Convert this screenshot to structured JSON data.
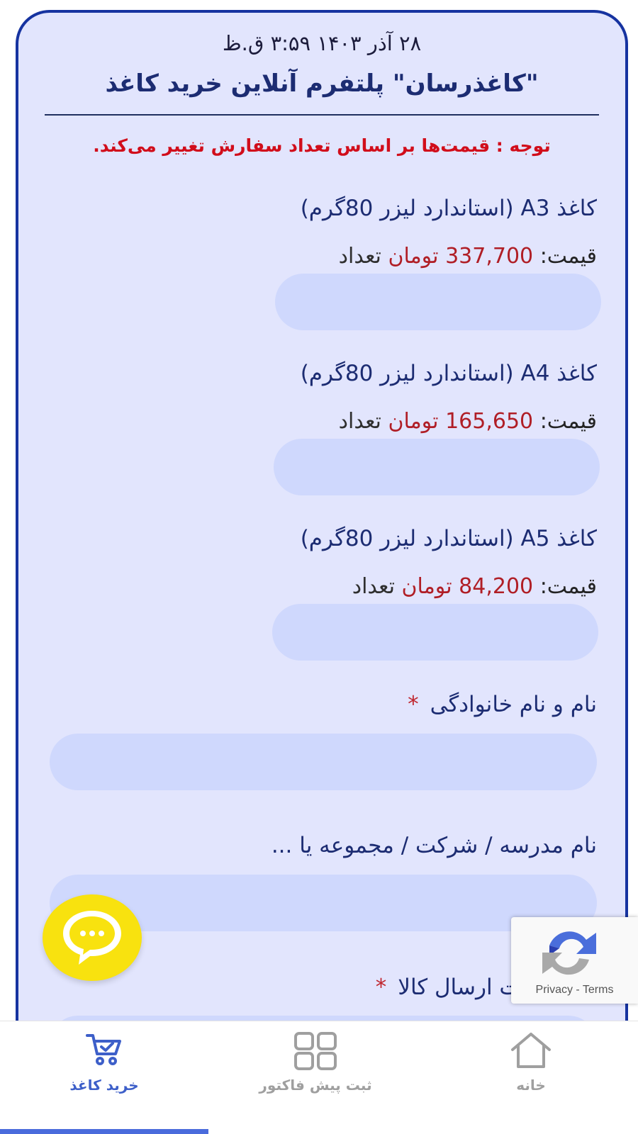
{
  "header": {
    "date": "۲۸ آذر ۱۴۰۳ ۳:۵۹ ق.ظ",
    "title": "\"کاغذرسان\" پلتفرم آنلاین خرید کاغذ",
    "notice": "توجه : قیمت‌ها بر اساس تعداد سفارش تغییر می‌کند."
  },
  "products": [
    {
      "name": "کاغذ A3 (استاندارد لیزر 80گرم)",
      "price_label": "قیمت:",
      "price": "337,700",
      "currency": "تومان",
      "qty_label": "تعداد",
      "qty_value": ""
    },
    {
      "name": "کاغذ A4 (استاندارد لیزر 80گرم)",
      "price_label": "قیمت:",
      "price": "165,650",
      "currency": "تومان",
      "qty_label": "تعداد",
      "qty_value": ""
    },
    {
      "name": "کاغذ A5 (استاندارد لیزر 80گرم)",
      "price_label": "قیمت:",
      "price": "84,200",
      "currency": "تومان",
      "qty_label": "تعداد",
      "qty_value": ""
    }
  ],
  "fields": {
    "full_name": {
      "label": "نام و نام خانوادگی",
      "required_mark": "*",
      "value": ""
    },
    "organization": {
      "label": "نام مدرسه / شرکت / مجموعه یا ...",
      "value": ""
    },
    "address": {
      "label": "دقیق جهت ارسال کالا",
      "required_mark": "*"
    }
  },
  "recaptcha": {
    "privacy": "Privacy",
    "separator": " - ",
    "terms": "Terms"
  },
  "nav": {
    "buy_label": "خرید کاغذ",
    "invoice_label": "ثبت پیش فاکتور",
    "home_label": "خانه",
    "active": "buy"
  },
  "colors": {
    "card_bg": "#e2e5fd",
    "card_border": "#1633a0",
    "input_bg": "#cfd8fd",
    "title": "#1c2c72",
    "notice": "#d10d1b",
    "price": "#b01e26",
    "chat_fab": "#f8e20f",
    "nav_active": "#3d5fc9",
    "nav_inactive": "#9f9f9f"
  }
}
